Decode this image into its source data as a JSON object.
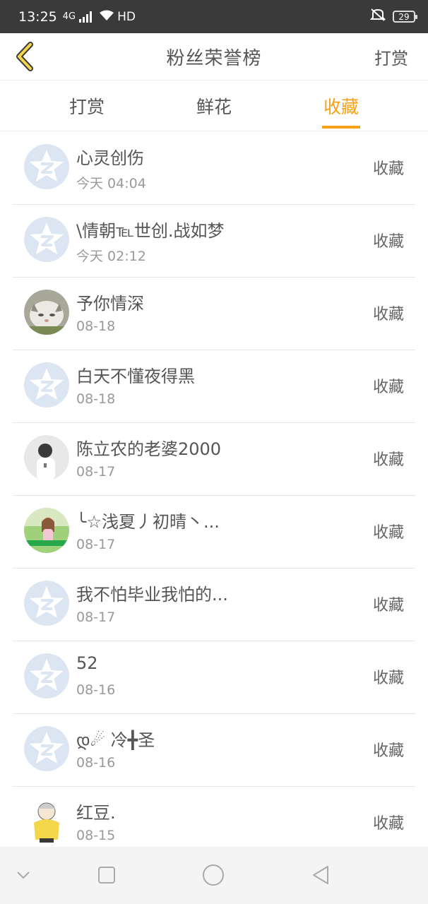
{
  "status_bar": {
    "time": "13:25",
    "network": "4G",
    "wifi_label": "HD",
    "battery": "29"
  },
  "header": {
    "title": "粉丝荣誉榜",
    "action_label": "打赏"
  },
  "tabs": [
    {
      "label": "打赏",
      "active": false
    },
    {
      "label": "鲜花",
      "active": false
    },
    {
      "label": "收藏",
      "active": true
    }
  ],
  "colors": {
    "accent": "#f5a11a",
    "status_bar_bg": "#3a3a3a",
    "default_avatar": "#dbe6f2"
  },
  "fans": [
    {
      "name": "心灵创伤",
      "date": "今天 04:04",
      "type": "收藏",
      "avatar": "default-star-icon"
    },
    {
      "name": "\\情朝℡世创.战如梦",
      "date": "今天 02:12",
      "type": "收藏",
      "avatar": "default-star-icon"
    },
    {
      "name": "予你情深",
      "date": "08-18",
      "type": "收藏",
      "avatar": "cat-photo"
    },
    {
      "name": "白天不懂夜得黑",
      "date": "08-18",
      "type": "收藏",
      "avatar": "default-star-icon"
    },
    {
      "name": "陈立农的老婆2000",
      "date": "08-17",
      "type": "收藏",
      "avatar": "person-photo"
    },
    {
      "name": "╰☆浅夏丿初晴丶...",
      "date": "08-17",
      "type": "收藏",
      "avatar": "girl-photo"
    },
    {
      "name": "我不怕毕业我怕的...",
      "date": "08-17",
      "type": "收藏",
      "avatar": "default-star-icon"
    },
    {
      "name": "52",
      "date": "08-16",
      "type": "收藏",
      "avatar": "default-star-icon"
    },
    {
      "name": "დ☄ 冷╋圣",
      "date": "08-16",
      "type": "收藏",
      "avatar": "default-star-icon"
    },
    {
      "name": "红豆.",
      "date": "08-15",
      "type": "收藏",
      "avatar": "cartoon-photo"
    }
  ]
}
